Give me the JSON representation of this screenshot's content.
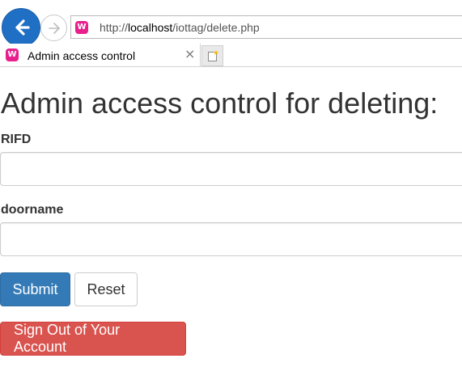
{
  "browser": {
    "url_prefix": "http://",
    "url_host": "localhost",
    "url_path": "/iottag/delete.php",
    "site_icon_glyph": "W",
    "tab_title": "Admin access control",
    "tab_close_glyph": "×",
    "icons": {
      "back": "back-arrow-icon",
      "forward": "forward-arrow-icon",
      "new_tab": "new-tab-icon"
    }
  },
  "page": {
    "heading": "Admin access control for deleting:",
    "form": {
      "rfid_label": "RIFD",
      "rfid_value": "",
      "doorname_label": "doorname",
      "doorname_value": "",
      "submit_label": "Submit",
      "reset_label": "Reset"
    },
    "signout_label": "Sign Out of Your Account"
  },
  "colors": {
    "primary": "#337ab7",
    "danger": "#d9534f",
    "back_button": "#1f6fc4",
    "site_icon": "#e8208e"
  }
}
